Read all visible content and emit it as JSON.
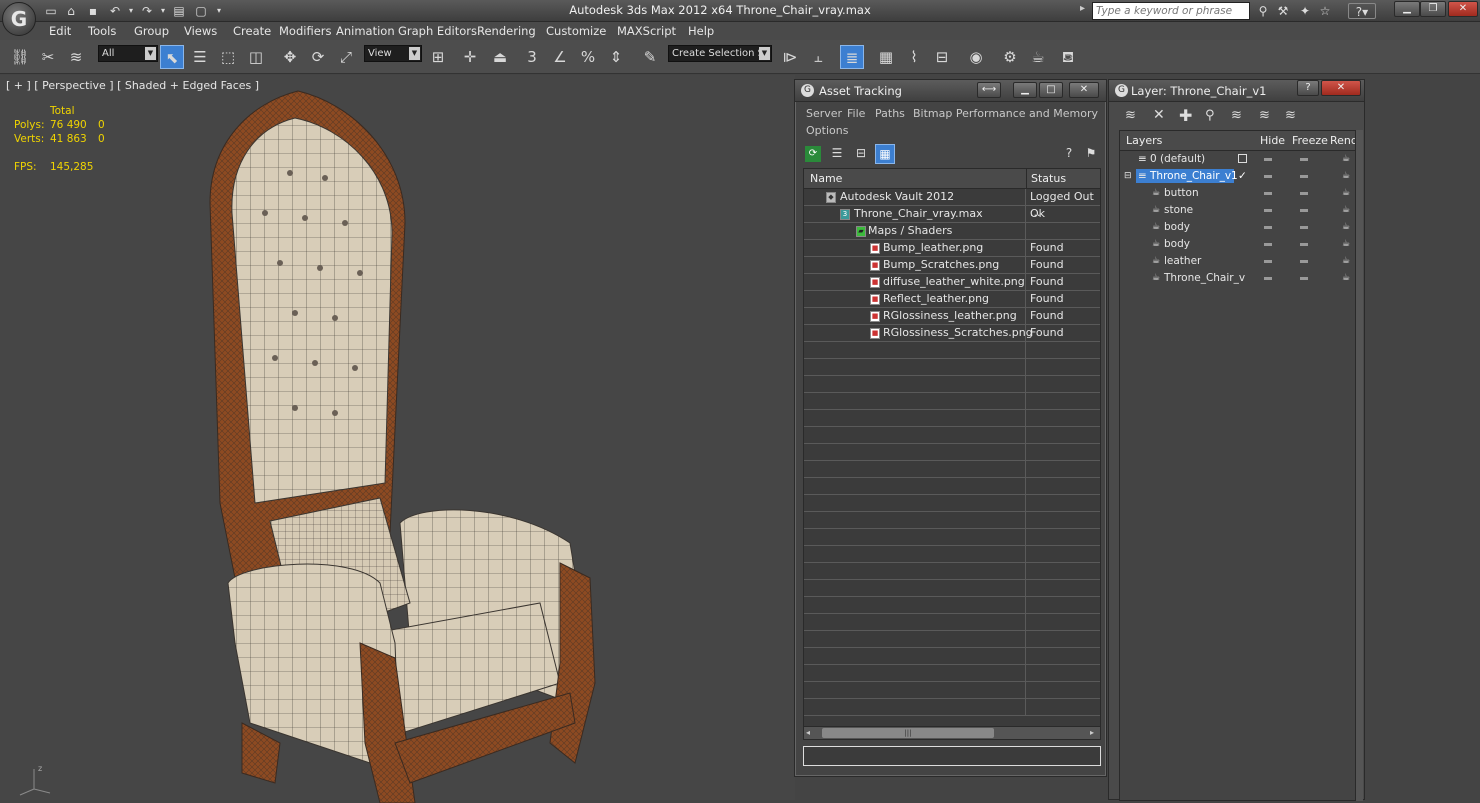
{
  "app": {
    "logo": "G",
    "title": "Autodesk 3ds Max  2012 x64     Throne_Chair_vray.max",
    "search_placeholder": "Type a keyword or phrase"
  },
  "menu": [
    "Edit",
    "Tools",
    "Group",
    "Views",
    "Create",
    "Modifiers",
    "Animation",
    "Graph Editors",
    "Rendering",
    "Customize",
    "MAXScript",
    "Help"
  ],
  "toolbar": {
    "filter_value": "All",
    "coord_value": "View",
    "selection_set_value": "Create Selection Se"
  },
  "viewport": {
    "label": "[ + ] [ Perspective ] [ Shaded + Edged Faces ]",
    "stats_header": "Total",
    "polys_label": "Polys:",
    "polys_total": "76 490",
    "polys_sel": "0",
    "verts_label": "Verts:",
    "verts_total": "41 863",
    "verts_sel": "0",
    "fps_label": "FPS:",
    "fps_value": "145,285"
  },
  "asset_tracking": {
    "title": "Asset Tracking",
    "menu": [
      "Server",
      "File",
      "Paths",
      "Bitmap Performance and Memory"
    ],
    "menu2": "Options",
    "col_name": "Name",
    "col_status": "Status",
    "rows": [
      {
        "name": "Autodesk Vault 2012",
        "status": "Logged Out ..."
      },
      {
        "name": "Throne_Chair_vray.max",
        "status": "Ok"
      },
      {
        "name": "Maps / Shaders",
        "status": ""
      },
      {
        "name": "Bump_leather.png",
        "status": "Found"
      },
      {
        "name": "Bump_Scratches.png",
        "status": "Found"
      },
      {
        "name": "diffuse_leather_white.png",
        "status": "Found"
      },
      {
        "name": "Reflect_leather.png",
        "status": "Found"
      },
      {
        "name": "RGlossiness_leather.png",
        "status": "Found"
      },
      {
        "name": "RGlossiness_Scratches.png",
        "status": "Found"
      }
    ]
  },
  "layer_dialog": {
    "title": "Layer: Throne_Chair_v1",
    "col_layers": "Layers",
    "col_hide": "Hide",
    "col_freeze": "Freeze",
    "col_render": "Rende",
    "rows": [
      "0 (default)",
      "Throne_Chair_v1",
      "button",
      "stone",
      "body",
      "body",
      "leather",
      "Throne_Chair_v"
    ]
  },
  "colors": {
    "selection_blue": "#3c7fd1",
    "stat_yellow": "#f0d400",
    "wood": "#a0522d",
    "leather": "#d8cdb8"
  }
}
